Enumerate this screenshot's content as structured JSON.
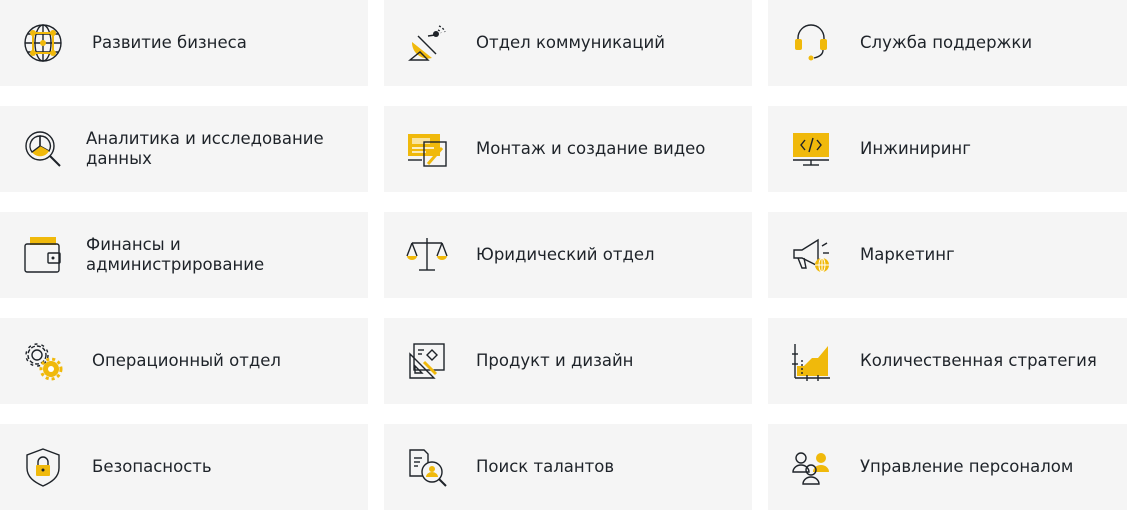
{
  "colors": {
    "accent": "#f0b90b",
    "card_bg": "#f5f5f5",
    "text": "#1e2329",
    "icon_stroke": "#1e2329"
  },
  "departments": [
    {
      "label": "Развитие бизнеса",
      "icon": "globe-icon"
    },
    {
      "label": "Отдел коммуникаций",
      "icon": "satellite-dish-icon"
    },
    {
      "label": "Служба поддержки",
      "icon": "headset-icon"
    },
    {
      "label": "Аналитика и исследование данных",
      "icon": "magnifier-pie-chart-icon"
    },
    {
      "label": "Монтаж и создание видео",
      "icon": "video-editing-icon"
    },
    {
      "label": "Инжиниринг",
      "icon": "code-monitor-icon"
    },
    {
      "label": "Финансы и администрирование",
      "icon": "wallet-icon"
    },
    {
      "label": "Юридический отдел",
      "icon": "scales-icon"
    },
    {
      "label": "Маркетинг",
      "icon": "megaphone-icon"
    },
    {
      "label": "Операционный отдел",
      "icon": "gears-icon"
    },
    {
      "label": "Продукт и дизайн",
      "icon": "design-tools-icon"
    },
    {
      "label": "Количественная стратегия",
      "icon": "area-chart-icon"
    },
    {
      "label": "Безопасность",
      "icon": "shield-lock-icon"
    },
    {
      "label": "Поиск талантов",
      "icon": "talent-search-icon"
    },
    {
      "label": "Управление персоналом",
      "icon": "people-group-icon"
    }
  ]
}
